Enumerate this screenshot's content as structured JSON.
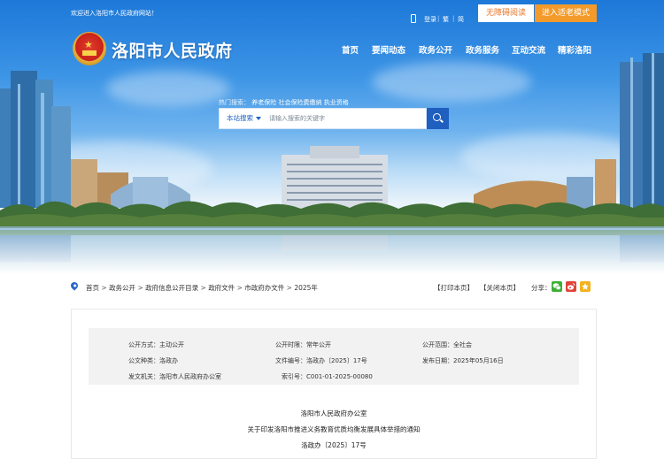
{
  "topbar": {
    "welcome": "欢迎进入洛阳市人民政府网站！",
    "links": [
      "登录",
      "繁",
      "简"
    ],
    "accessible_label": "无障碍阅读",
    "elder_label": "进入适老模式"
  },
  "site": {
    "title": "洛阳市人民政府"
  },
  "nav": [
    "首页",
    "要闻动态",
    "政务公开",
    "政务服务",
    "互动交流",
    "精彩洛阳"
  ],
  "search": {
    "hot_label": "热门搜索：",
    "hot_terms": [
      "养老保险",
      "社会保险费缴纳",
      "执业资格"
    ],
    "scope": "本站搜索",
    "placeholder": "请输入搜索的关键字"
  },
  "breadcrumb": [
    "首页",
    "政务公开",
    "政府信息公开目录",
    "政府文件",
    "市政府办文件",
    "2025年"
  ],
  "actions": {
    "print": "【打印本页】",
    "close": "【关闭本页】",
    "share_label": "分享："
  },
  "share_icons": [
    "wechat-icon",
    "weibo-icon",
    "qzone-icon"
  ],
  "metadata": [
    {
      "label": "公开方式：",
      "value": "主动公开"
    },
    {
      "label": "公开时限：",
      "value": "常年公开"
    },
    {
      "label": "公开范围：",
      "value": "全社会"
    },
    {
      "label": "公文种类：",
      "value": "洛政办"
    },
    {
      "label": "文件编号：",
      "value": "洛政办〔2025〕17号"
    },
    {
      "label": "发布日期：",
      "value": "2025年05月16日"
    },
    {
      "label": "发文机关：",
      "value": "洛阳市人民政府办公室"
    },
    {
      "label": "索引号：",
      "value": "C001-01-2025-00080"
    }
  ],
  "document": {
    "issuer": "洛阳市人民政府办公室",
    "title": "关于印发洛阳市推进义务教育优质均衡发展具体举措的通知",
    "number": "洛政办〔2025〕17号"
  },
  "colors": {
    "primary_blue": "#1f5fbf",
    "accent_orange": "#f39a2a",
    "accessible_text": "#e8772a",
    "meta_bg": "#f2f2f2"
  }
}
